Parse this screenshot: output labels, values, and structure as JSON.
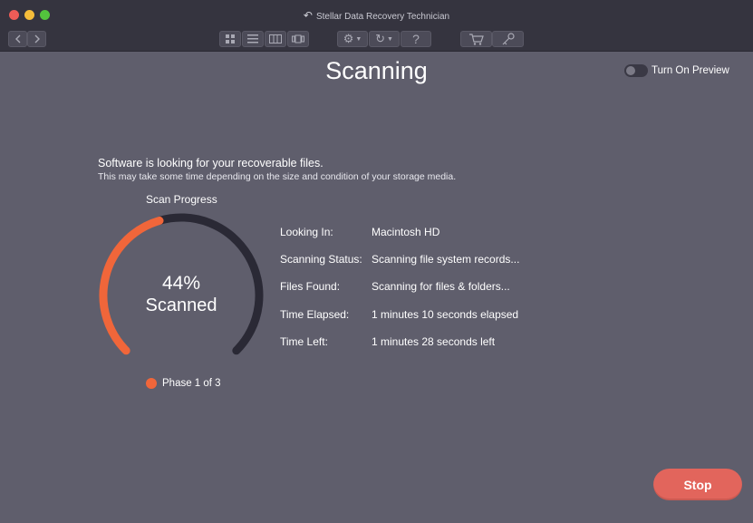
{
  "window": {
    "title": "Stellar Data Recovery Technician"
  },
  "toolbar": {
    "icons": [
      "back-icon",
      "forward-icon",
      "icon-view-icon",
      "list-view-icon",
      "column-view-icon",
      "cover-flow-icon",
      "gear-icon",
      "history-icon",
      "help-icon",
      "cart-icon",
      "key-icon"
    ],
    "help_label": "?"
  },
  "main": {
    "title": "Scanning",
    "preview_toggle": {
      "label": "Turn On Preview",
      "on": false
    },
    "message": "Software is looking for your recoverable files.",
    "submessage": "This may take some time depending on the size and condition of your storage media."
  },
  "progress": {
    "heading": "Scan Progress",
    "percent": 44,
    "percent_text": "44%",
    "status_word": "Scanned",
    "phase": "Phase 1 of 3"
  },
  "info": {
    "looking_in_label": "Looking In:",
    "looking_in_value": "Macintosh HD",
    "status_label": "Scanning Status:",
    "status_value": "Scanning file system records...",
    "files_label": "Files Found:",
    "files_value": "Scanning for files & folders...",
    "elapsed_label": "Time Elapsed:",
    "elapsed_value": "1 minutes 10 seconds elapsed",
    "left_label": "Time Left:",
    "left_value": "1 minutes 28 seconds left"
  },
  "stop_label": "Stop",
  "colors": {
    "background": "#5f5e6c",
    "bar": "#35343f",
    "accent": "#f0663a",
    "track": "#2a2935",
    "stop": "#e2655c"
  }
}
